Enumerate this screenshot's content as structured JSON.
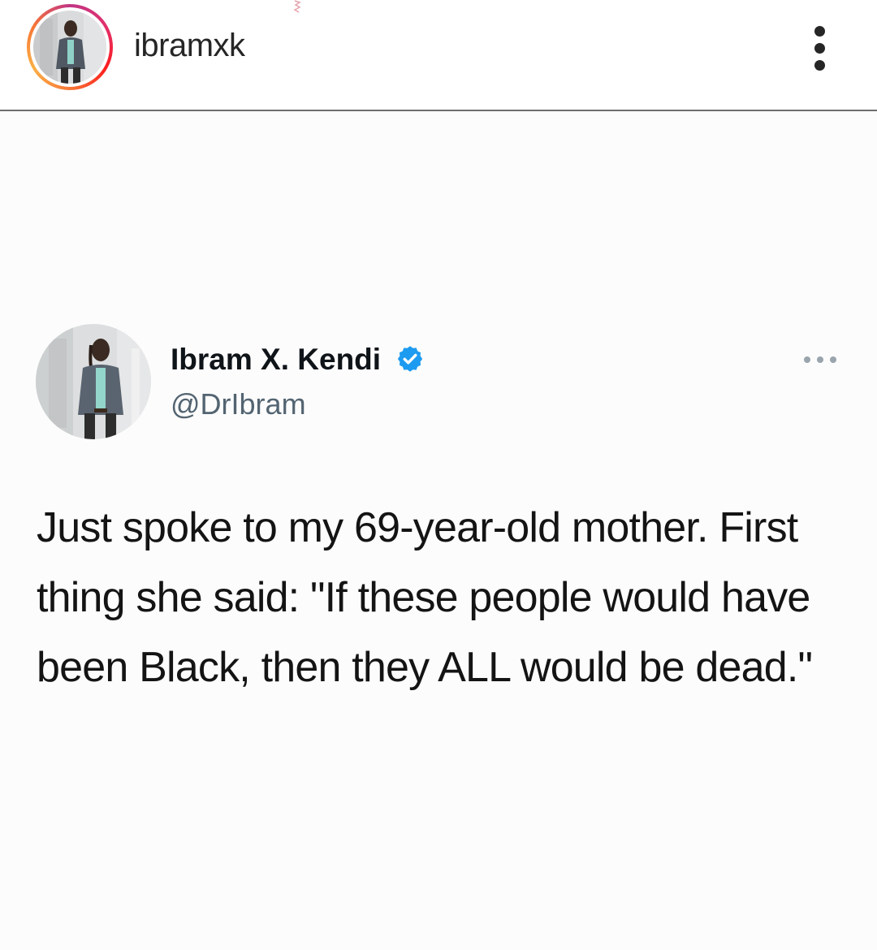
{
  "instagram": {
    "username": "ibramxk",
    "avatar_icon": "profile-photo-icon",
    "options_icon": "more-vertical-icon",
    "story_ring_colors": [
      "#c13584",
      "#e1306c",
      "#fd1d1d",
      "#f77737",
      "#fcaf45"
    ]
  },
  "tweet": {
    "display_name": "Ibram X. Kendi",
    "handle": "@DrIbram",
    "verified_icon": "verified-badge-icon",
    "verified_color": "#1d9bf0",
    "more_icon": "more-horizontal-icon",
    "text": "Just spoke to my 69-year-old mother. First thing she said: \"If these people would have been Black, then they ALL would be dead.\""
  }
}
